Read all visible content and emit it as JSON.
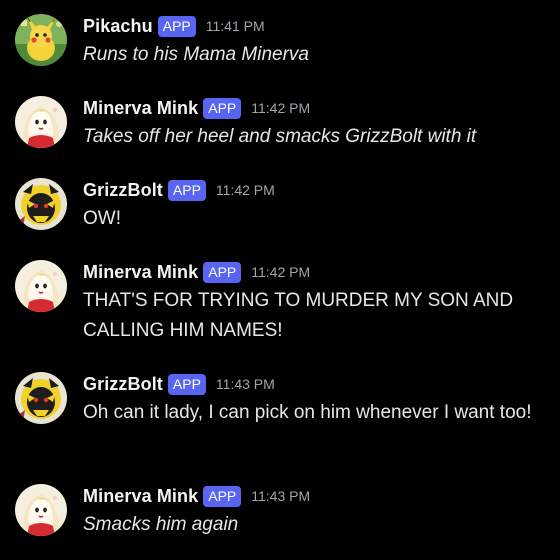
{
  "messages": [
    {
      "username": "Pikachu",
      "badge": "APP",
      "time": "11:41 PM",
      "text": "Runs to his Mama Minerva",
      "italic": true,
      "avatar": "pikachu-avatar"
    },
    {
      "username": "Minerva Mink",
      "badge": "APP",
      "time": "11:42 PM",
      "text": "Takes off her heel and smacks GrizzBolt with it",
      "italic": true,
      "avatar": "minerva-avatar"
    },
    {
      "username": "GrizzBolt",
      "badge": "APP",
      "time": "11:42 PM",
      "text": "OW!",
      "italic": false,
      "avatar": "grizzbolt-avatar"
    },
    {
      "username": "Minerva Mink",
      "badge": "APP",
      "time": "11:42 PM",
      "text": "THAT'S FOR TRYING TO MURDER MY SON AND CALLING HIM NAMES!",
      "italic": false,
      "avatar": "minerva-avatar"
    },
    {
      "username": "GrizzBolt",
      "badge": "APP",
      "time": "11:43 PM",
      "text": "Oh can it lady, I can pick on him whenever I want too!",
      "italic": false,
      "avatar": "grizzbolt-avatar"
    },
    {
      "username": "Minerva Mink",
      "badge": "APP",
      "time": "11:43 PM",
      "text": "Smacks him again",
      "italic": true,
      "avatar": "minerva-avatar"
    }
  ],
  "colors": {
    "background": "#000000",
    "badge": "#5865f2",
    "username": "#f2f3f5",
    "timestamp": "#a2a5ad",
    "message_text": "#e6e7ea"
  }
}
